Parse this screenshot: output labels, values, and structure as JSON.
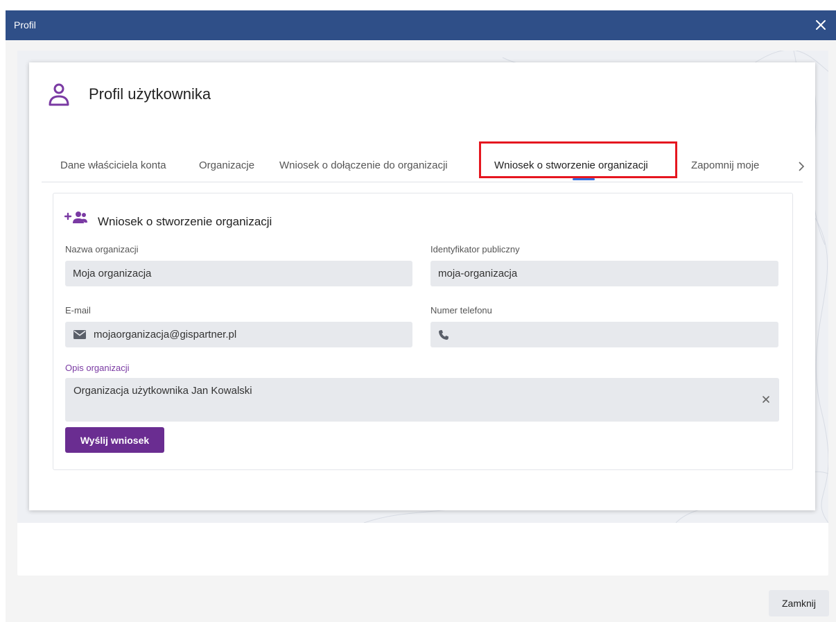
{
  "window": {
    "title": "Profil"
  },
  "card": {
    "title": "Profil użytkownika"
  },
  "tabs": [
    {
      "label": "Dane właściciela konta"
    },
    {
      "label": "Organizacje"
    },
    {
      "label": "Wniosek o dołączenie do organizacji"
    },
    {
      "label": "Wniosek o stworzenie organizacji"
    },
    {
      "label": "Zapomnij moje"
    }
  ],
  "active_tab": 3,
  "form": {
    "title": "Wniosek o stworzenie organizacji",
    "name_label": "Nazwa organizacji",
    "name_value": "Moja organizacja",
    "public_id_label": "Identyfikator publiczny",
    "public_id_value": "moja-organizacja",
    "email_label": "E-mail",
    "email_value": "mojaorganizacja@gispartner.pl",
    "phone_label": "Numer telefonu",
    "phone_value": "",
    "description_label": "Opis organizacji",
    "description_value": "Organizacja użytkownika Jan Kowalski",
    "submit_label": "Wyślij wniosek"
  },
  "footer": {
    "close_label": "Zamknij"
  },
  "icons": {
    "close": "close-icon",
    "user": "user-icon",
    "add_group": "add-group-icon",
    "email": "envelope-icon",
    "phone": "phone-icon",
    "chevron": "chevron-right-icon",
    "clear": "clear-icon"
  },
  "colors": {
    "titlebar": "#2f4f88",
    "accent": "#6a2d91",
    "tab_indicator": "#2f6fe0",
    "highlight_border": "#e5161f",
    "field_bg": "#e7e9ed"
  }
}
